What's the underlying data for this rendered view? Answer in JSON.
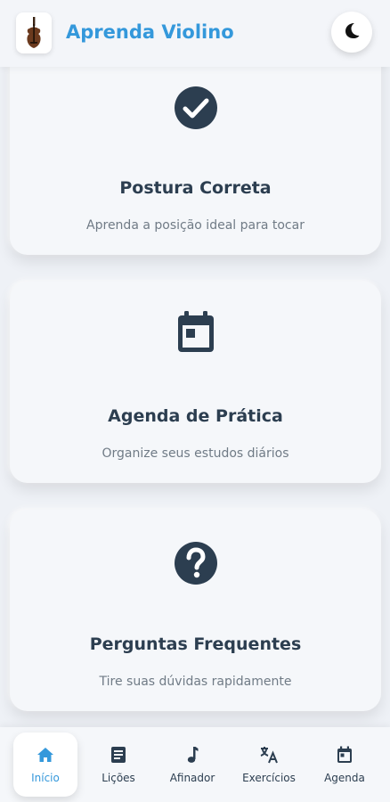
{
  "app": {
    "title": "Aprenda Violino",
    "logo_icon": "violin-icon",
    "theme_toggle_icon": "moon-icon"
  },
  "colors": {
    "accent": "#3498db",
    "dark": "#2c3e50",
    "background": "#eef1f6"
  },
  "cards": [
    {
      "icon": "check-circle-icon",
      "title": "Postura Correta",
      "description": "Aprenda a posição ideal para tocar"
    },
    {
      "icon": "calendar-icon",
      "title": "Agenda de Prática",
      "description": "Organize seus estudos diários"
    },
    {
      "icon": "question-circle-icon",
      "title": "Perguntas Frequentes",
      "description": "Tire suas dúvidas rapidamente"
    }
  ],
  "nav": {
    "items": [
      {
        "label": "Início",
        "icon": "home-icon",
        "active": true
      },
      {
        "label": "Lições",
        "icon": "book-icon",
        "active": false
      },
      {
        "label": "Afinador",
        "icon": "music-note-icon",
        "active": false
      },
      {
        "label": "Exercícios",
        "icon": "translate-icon",
        "active": false
      },
      {
        "label": "Agenda",
        "icon": "calendar-icon",
        "active": false
      }
    ]
  }
}
